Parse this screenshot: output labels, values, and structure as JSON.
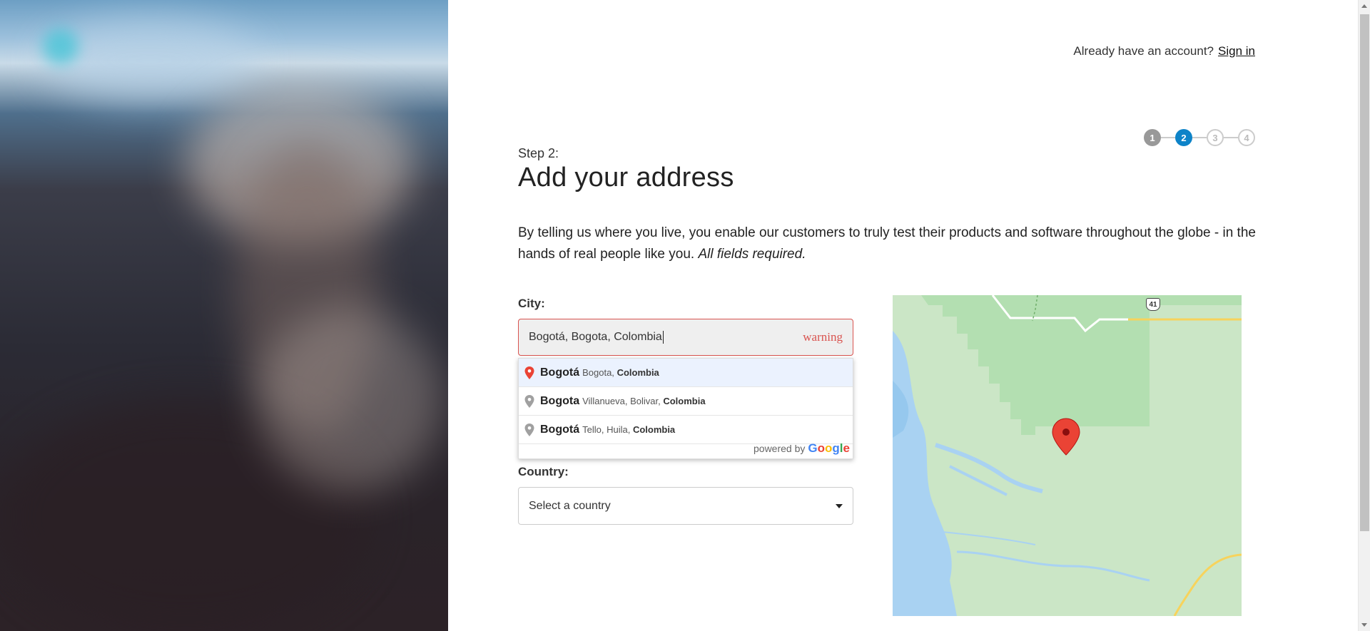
{
  "header": {
    "account_prompt": "Already have an account?",
    "signin_label": "Sign in"
  },
  "stepper": {
    "steps": [
      "1",
      "2",
      "3",
      "4"
    ],
    "current": 2
  },
  "page": {
    "step_label": "Step 2:",
    "title": "Add your address",
    "intro": "By telling us where you live, you enable our customers to truly test their products and software throughout the globe - in the hands of real people like you.",
    "intro_emphasis": "All fields required."
  },
  "form": {
    "city_label": "City:",
    "city_value": "Bogotá, Bogota, Colombia",
    "city_warning": "warning",
    "country_label": "Country:",
    "country_value": "Select a country"
  },
  "autocomplete": {
    "items": [
      {
        "main": "Bogotá",
        "secondary": "Bogota,",
        "country": "Colombia"
      },
      {
        "main": "Bogota",
        "secondary": "Villanueva, Bolivar,",
        "country": "Colombia"
      },
      {
        "main": "Bogotá",
        "secondary": "Tello, Huila,",
        "country": "Colombia"
      }
    ],
    "powered_by": "powered by",
    "brand": "Google"
  },
  "map": {
    "route_shield": "41"
  },
  "colors": {
    "accent": "#0d83c8",
    "error": "#d9534f",
    "map_land": "#cbe6c6",
    "map_park": "#b3dfb1",
    "map_water": "#a9d2f2",
    "marker": "#ea4335"
  }
}
